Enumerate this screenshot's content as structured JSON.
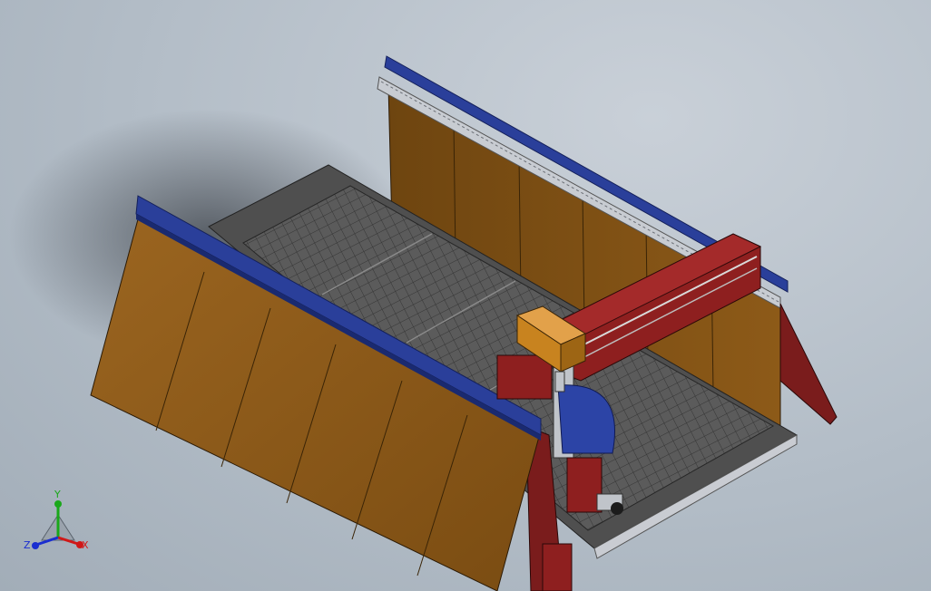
{
  "viewport": {
    "background": "#b3bdc7"
  },
  "model": {
    "parts": [
      "cnc-router-frame",
      "left-side-plate",
      "right-side-plate",
      "left-rail",
      "right-rail",
      "vacuum-bed",
      "gantry-beam",
      "spindle-carriage",
      "spindle-motor",
      "z-axis-assembly"
    ],
    "colors": {
      "side_plate": "#8a5a1a",
      "rail": "#2a3f9a",
      "gantry": "#8e1f1f",
      "table": "#5a5a5a",
      "grid": "#3c3c3c",
      "spindle": "#d28d2e",
      "z_cover": "#2c44a6",
      "frame_base": "#7a1c1c"
    }
  },
  "triad": {
    "x_label": "X",
    "y_label": "Y",
    "z_label": "Z",
    "x_color": "#d01818",
    "y_color": "#1aa81a",
    "z_color": "#1a2ed0"
  }
}
